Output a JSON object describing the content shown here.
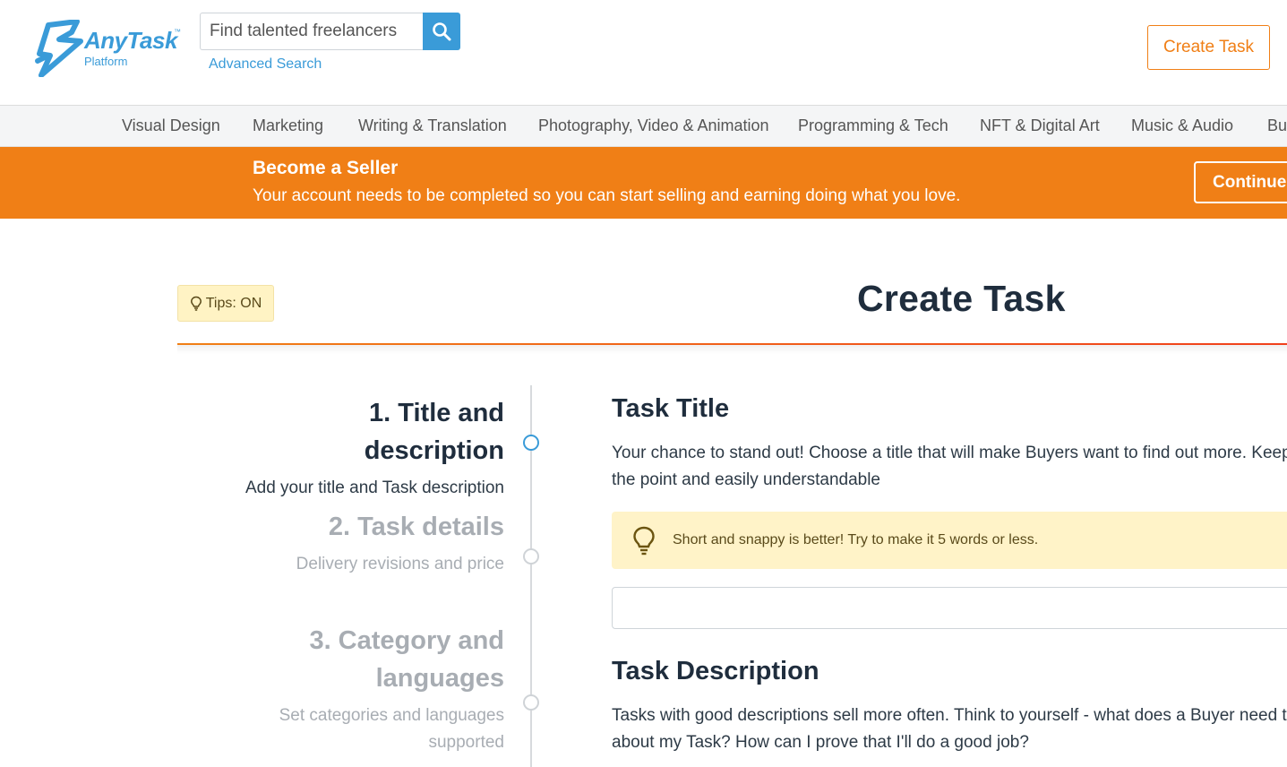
{
  "brand": {
    "name": "AnyTask",
    "tm": "™",
    "sub": "Platform",
    "color": "#3a9bd8"
  },
  "search": {
    "placeholder": "Find talented freelancers",
    "advanced_label": "Advanced Search"
  },
  "header": {
    "create_task_label": "Create Task"
  },
  "categories": [
    "Visual Design",
    "Marketing",
    "Writing & Translation",
    "Photography, Video & Animation",
    "Programming & Tech",
    "NFT & Digital Art",
    "Music & Audio",
    "Business"
  ],
  "banner": {
    "title": "Become a Seller",
    "text": "Your account needs to be completed so you can start selling and earning doing what you love.",
    "button_label": "Continue",
    "color": "#f07f16"
  },
  "tips": {
    "label": "Tips: ON"
  },
  "page": {
    "title": "Create Task"
  },
  "steps": [
    {
      "title": "1. Title and description",
      "sub": "Add your title and Task description",
      "state": "active"
    },
    {
      "title": "2. Task details",
      "sub": "Delivery revisions and price",
      "state": "inactive"
    },
    {
      "title": "3. Category and languages",
      "sub": "Set categories and languages supported",
      "state": "inactive"
    }
  ],
  "form": {
    "task_title": {
      "heading": "Task Title",
      "line1": "Your chance to stand out! Choose a title that will make Buyers want to find out more. Keep it to",
      "line2": "the point and easily understandable",
      "hint": "Short and snappy is better! Try to make it 5 words or less.",
      "value": ""
    },
    "task_description": {
      "heading": "Task Description",
      "line1": "Tasks with good descriptions sell more often. Think to yourself - what does a Buyer need to know",
      "line2": "about my Task? How can I prove that I'll do a good job?"
    }
  }
}
